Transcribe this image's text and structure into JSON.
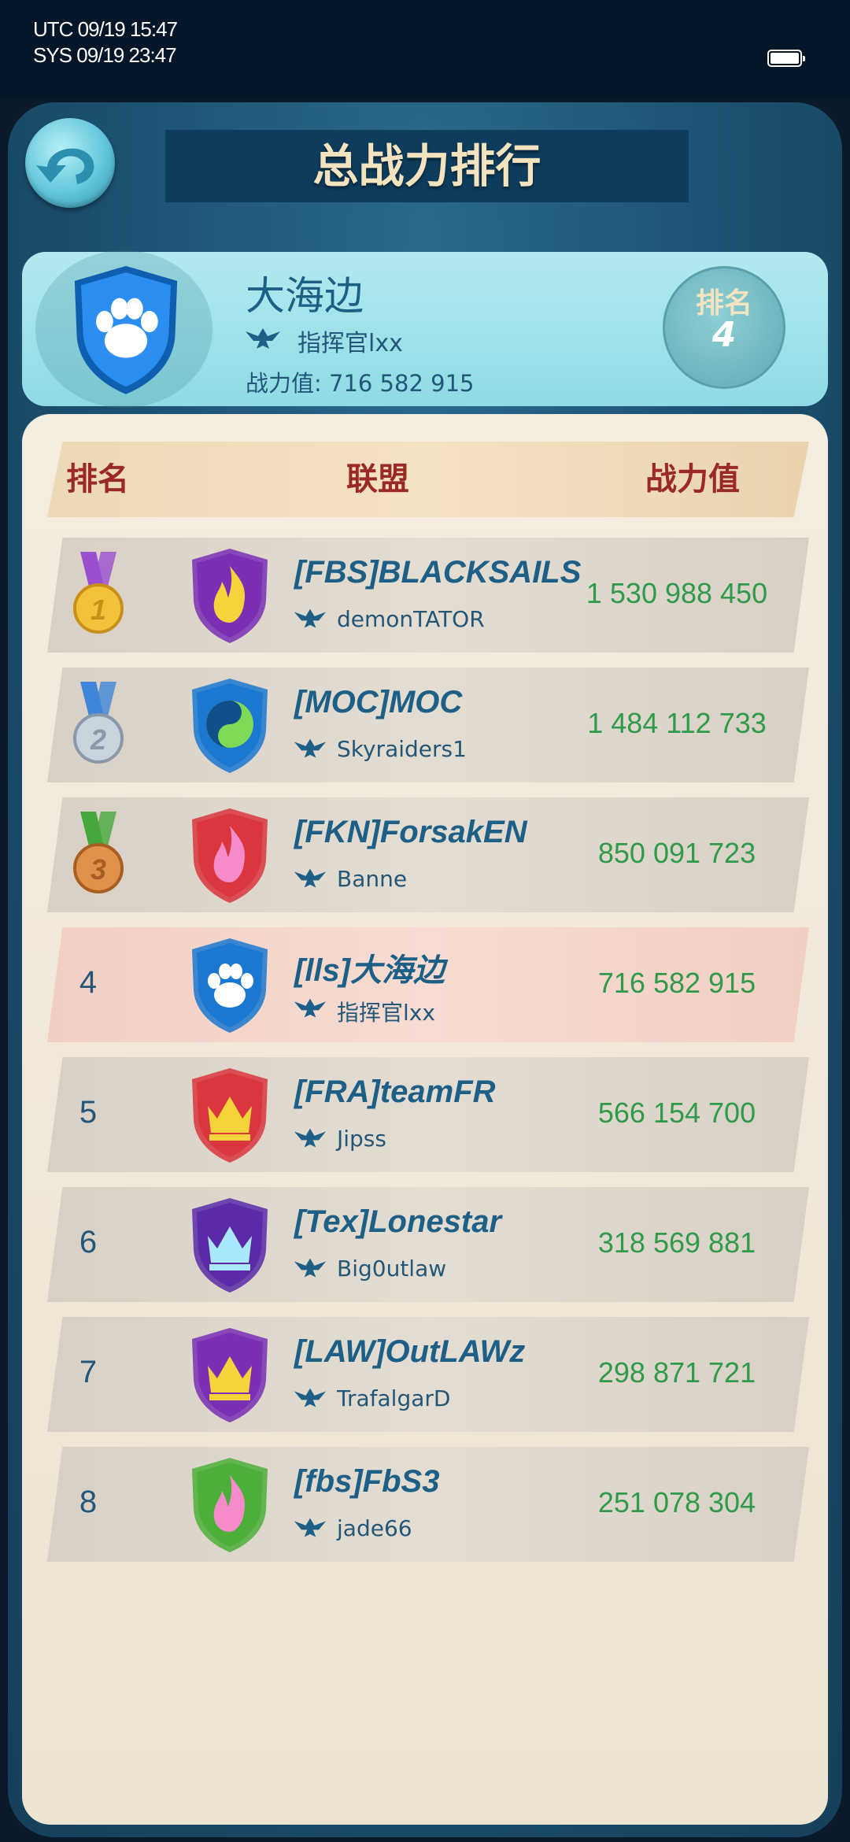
{
  "status_bar": {
    "utc": "UTC 09/19 15:47",
    "sys": "SYS 09/19 23:47"
  },
  "header": {
    "title": "总战力排行"
  },
  "my_alliance": {
    "name": "大海边",
    "leader": "指挥官lxx",
    "power_text": "战力值: 716 582 915",
    "rank_label": "排名",
    "rank": "4",
    "emblem": {
      "shape": "paw-shield",
      "color": "#1b78d0",
      "icon_color": "#ffffff"
    }
  },
  "table": {
    "columns": {
      "rank": "排名",
      "alliance": "联盟",
      "power": "战力值"
    },
    "rows": [
      {
        "rank": "1",
        "medal": "gold-medal",
        "name": "[FBS]BLACKSAILS",
        "leader": "demonTATOR",
        "power": "1 530 988 450",
        "emblem": {
          "shape": "fire",
          "color": "#7a2fb5",
          "icon_color": "#f6d23b"
        },
        "highlight": false
      },
      {
        "rank": "2",
        "medal": "silver-medal",
        "name": "[MOC]MOC",
        "leader": "Skyraiders1",
        "power": "1 484 112 733",
        "emblem": {
          "shape": "yinyang",
          "color": "#1b78d0",
          "icon_color": "#7ed957"
        },
        "highlight": false
      },
      {
        "rank": "3",
        "medal": "bronze-medal",
        "name": "[FKN]ForsakEN",
        "leader": "Banne",
        "power": "850 091 723",
        "emblem": {
          "shape": "fire",
          "color": "#d9363e",
          "icon_color": "#f58bc8"
        },
        "highlight": false
      },
      {
        "rank": "4",
        "medal": "",
        "name": "[lls]大海边",
        "leader": "指挥官lxx",
        "power": "716 582 915",
        "emblem": {
          "shape": "paw",
          "color": "#1b78d0",
          "icon_color": "#ffffff"
        },
        "highlight": true
      },
      {
        "rank": "5",
        "medal": "",
        "name": "[FRA]teamFR",
        "leader": "Jipss",
        "power": "566 154 700",
        "emblem": {
          "shape": "crown",
          "color": "#d9363e",
          "icon_color": "#f6d23b"
        },
        "highlight": false
      },
      {
        "rank": "6",
        "medal": "",
        "name": "[Tex]Lonestar",
        "leader": "Big0utlaw",
        "power": "318 569 881",
        "emblem": {
          "shape": "crown",
          "color": "#5b2aa8",
          "icon_color": "#a9e8ff"
        },
        "highlight": false
      },
      {
        "rank": "7",
        "medal": "",
        "name": "[LAW]OutLAWz",
        "leader": "TrafalgarD",
        "power": "298 871 721",
        "emblem": {
          "shape": "crown",
          "color": "#7a2fb5",
          "icon_color": "#f6d23b"
        },
        "highlight": false
      },
      {
        "rank": "8",
        "medal": "",
        "name": "[fbs]FbS3",
        "leader": "jade66",
        "power": "251 078 304",
        "emblem": {
          "shape": "fire",
          "color": "#4caf3a",
          "icon_color": "#f58bc8"
        },
        "highlight": false
      }
    ]
  },
  "colors": {
    "alliance_name": "#1d5f86",
    "power_value": "#2e9a4a",
    "header_text": "#9b2a24",
    "highlight_row": "#f2cfc4"
  }
}
